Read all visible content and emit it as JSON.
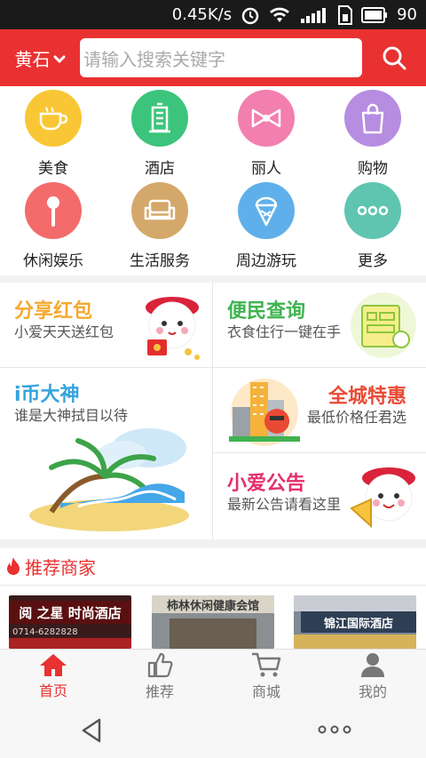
{
  "status": {
    "speed": "0.45K/s",
    "battery": "90"
  },
  "header": {
    "city": "黄石",
    "search_placeholder": "请输入搜索关键字"
  },
  "categories": [
    {
      "label": "美食",
      "color": "#f9c735"
    },
    {
      "label": "酒店",
      "color": "#3cc47c"
    },
    {
      "label": "丽人",
      "color": "#f27fae"
    },
    {
      "label": "购物",
      "color": "#b68de0"
    },
    {
      "label": "休闲娱乐",
      "color": "#f46b6b"
    },
    {
      "label": "生活服务",
      "color": "#d4a86a"
    },
    {
      "label": "周边游玩",
      "color": "#5fb0ea"
    },
    {
      "label": "更多",
      "color": "#5fc5b0"
    }
  ],
  "promos": {
    "share": {
      "title": "分享红包",
      "sub": "小爱天天送红包",
      "color": "#f4a92f"
    },
    "query": {
      "title": "便民查询",
      "sub": "衣食住行一键在手",
      "color": "#3fb34f"
    },
    "coin": {
      "title": "i币大神",
      "sub": "谁是大神拭目以待",
      "color": "#34a3e0"
    },
    "deal": {
      "title": "全城特惠",
      "sub": "最低价格任君选",
      "color": "#e94a35"
    },
    "notice": {
      "title": "小爱公告",
      "sub": "最新公告请看这里",
      "color": "#e3306b"
    }
  },
  "recommend": {
    "title": "推荐商家"
  },
  "shops": [
    {
      "sign": "阅 之星 时尚酒店",
      "phone": "0714-6282828"
    },
    {
      "sign": "柿林休闲健康会馆"
    },
    {
      "sign": "锦江国际酒店"
    }
  ],
  "tabs": [
    {
      "label": "首页"
    },
    {
      "label": "推荐"
    },
    {
      "label": "商城"
    },
    {
      "label": "我的"
    }
  ]
}
